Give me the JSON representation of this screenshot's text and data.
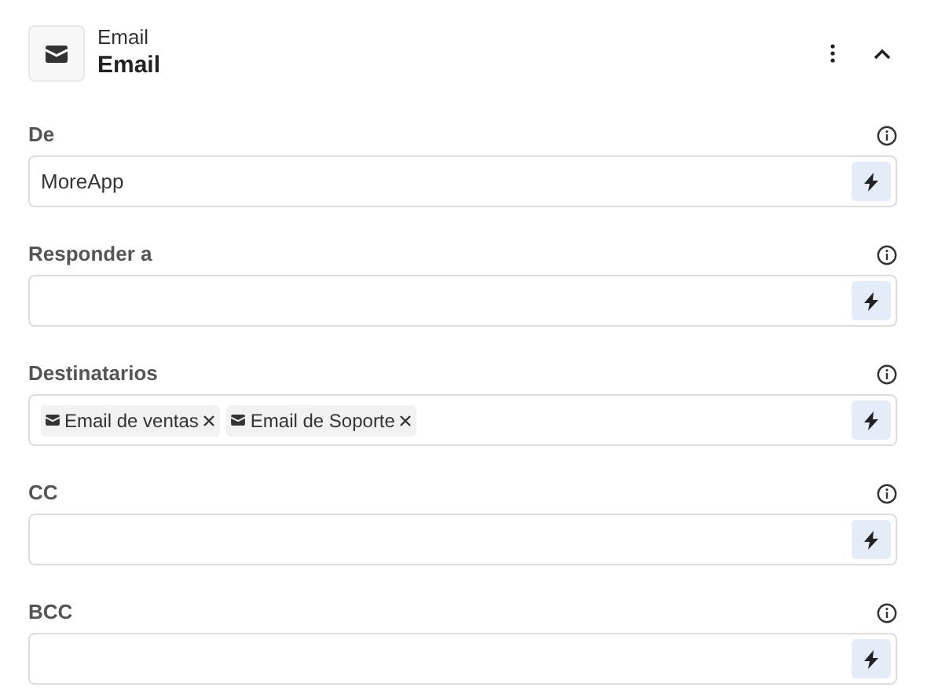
{
  "header": {
    "subtitle": "Email",
    "title": "Email"
  },
  "fields": [
    {
      "kind": "text",
      "label": "De",
      "value": "MoreApp"
    },
    {
      "kind": "text",
      "label": "Responder a"
    },
    {
      "kind": "tags",
      "label": "Destinatarios",
      "tags": [
        "Email de ventas",
        "Email de Soporte"
      ]
    },
    {
      "kind": "text",
      "label": "CC"
    },
    {
      "kind": "text",
      "label": "BCC"
    }
  ]
}
